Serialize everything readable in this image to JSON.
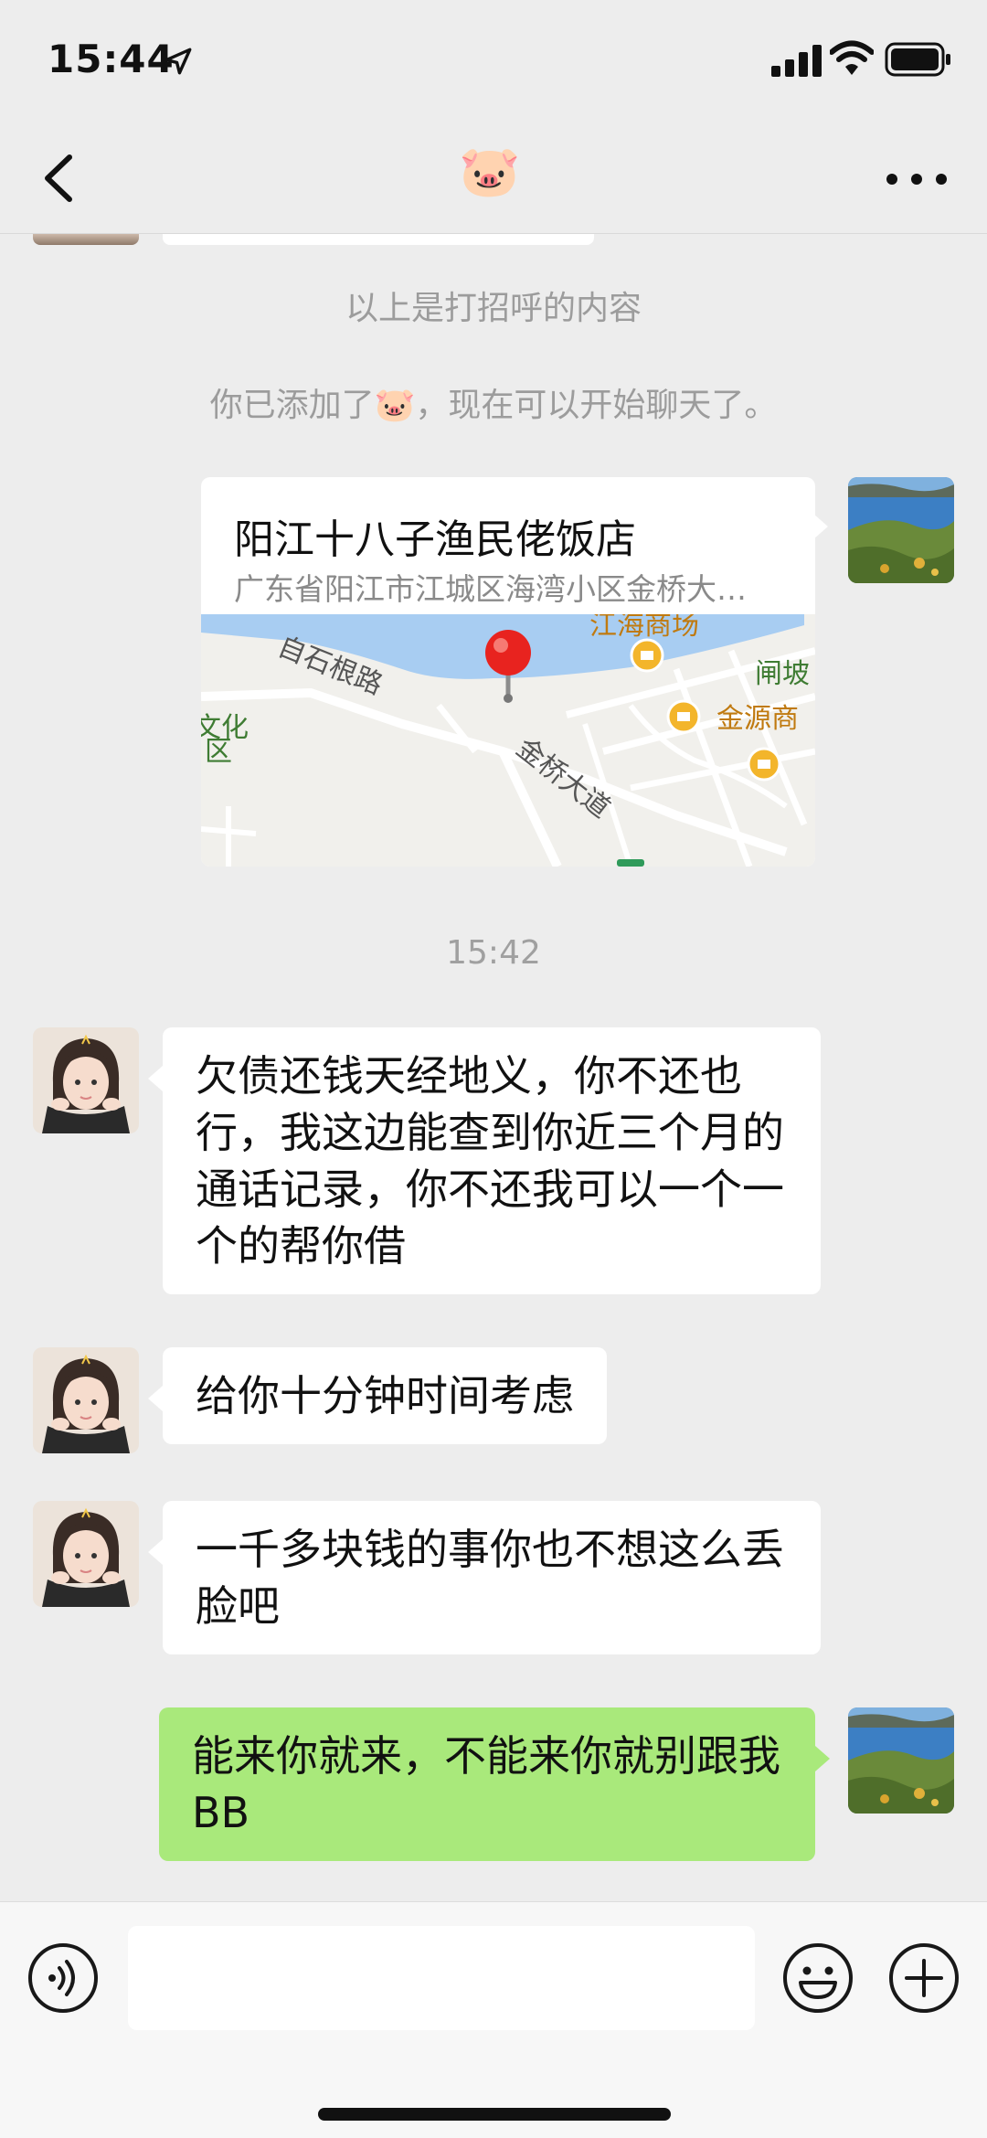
{
  "status_bar": {
    "time": "15:44"
  },
  "nav": {
    "title": "🐷"
  },
  "system_notes": {
    "greeting_divider": "以上是打招呼的内容",
    "added_notice": "你已添加了🐷，现在可以开始聊天了。",
    "timestamp": "15:42"
  },
  "location_card": {
    "name": "阳江十八子渔民佬饭店",
    "address": "广东省阳江市江城区海湾小区金桥大…",
    "map_labels": {
      "road_1": "自石根路",
      "road_2": "金桥大道",
      "poi_1": "江海商场",
      "poi_2": "闸坡",
      "poi_3": "金源商",
      "poi_4": "文化",
      "poi_4b": "区"
    }
  },
  "messages": [
    {
      "sender": "contact",
      "text": "欠债还钱天经地义，你不还也行，我这边能查到你近三个月的通话记录，你不还我可以一个一个的帮你借"
    },
    {
      "sender": "contact",
      "text": "给你十分钟时间考虑"
    },
    {
      "sender": "contact",
      "text": "一千多块钱的事你也不想这么丢脸吧"
    },
    {
      "sender": "me",
      "text": "能来你就来，不能来你就别跟我 BB"
    }
  ],
  "colors": {
    "background": "#ededed",
    "incoming_bubble": "#ffffff",
    "outgoing_bubble": "#a9e97b",
    "system_text": "#9c9c9c",
    "map_water": "#a8cdf2",
    "map_pin": "#e8231f"
  },
  "icons": {
    "back": "chevron-left-icon",
    "more": "ellipsis-icon",
    "voice": "voice-icon",
    "emoji": "smiley-icon",
    "plus": "plus-circle-icon"
  }
}
